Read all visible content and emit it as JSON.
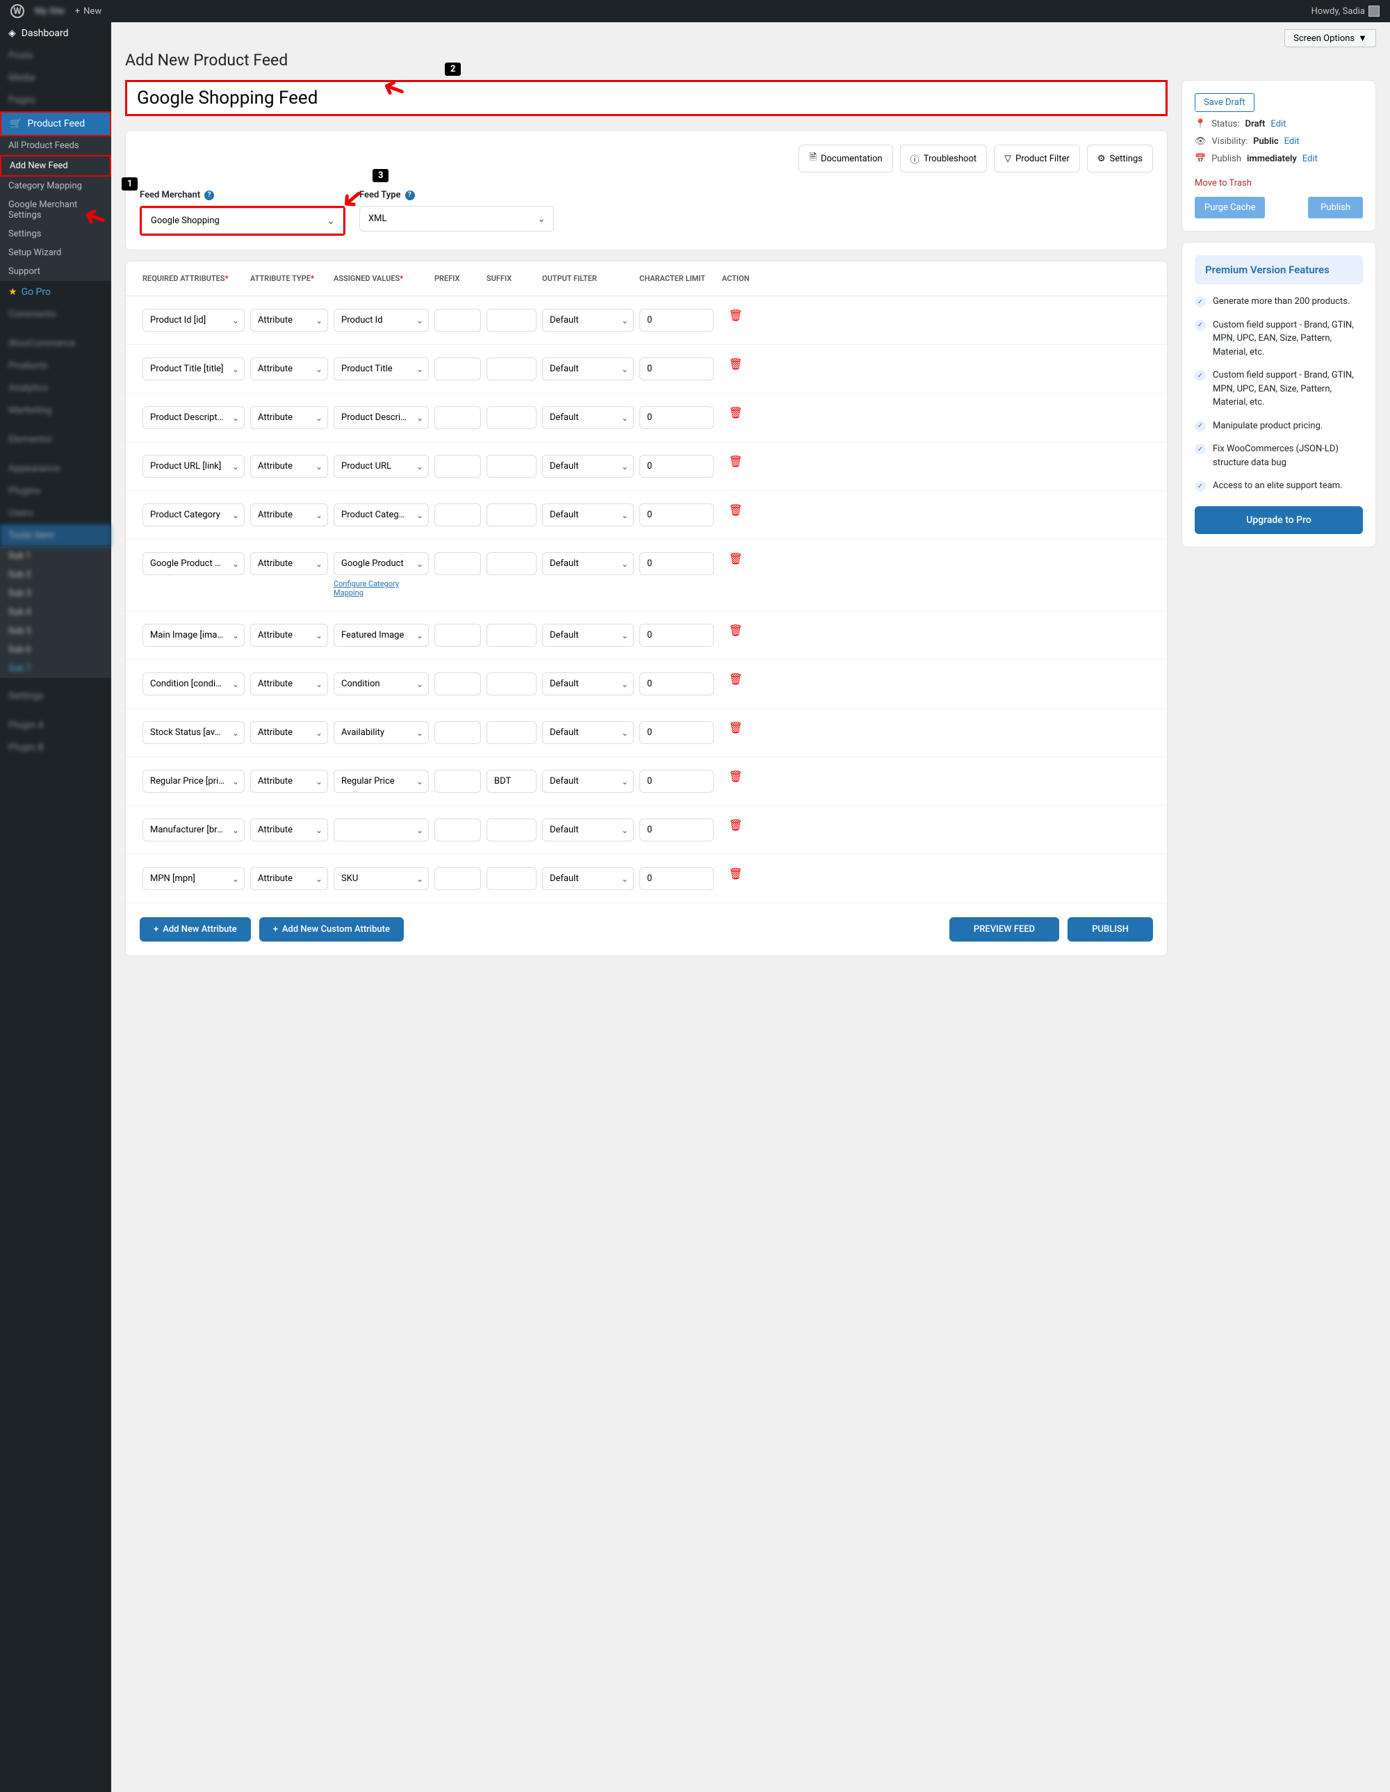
{
  "adminbar": {
    "new": "New",
    "howdy": "Howdy, Sadia"
  },
  "sidebar": {
    "dashboard": "Dashboard",
    "product_feed": "Product Feed",
    "submenu": [
      "All Product Feeds",
      "Add New Feed",
      "Category Mapping",
      "Google Merchant Settings",
      "Settings",
      "Setup Wizard",
      "Support"
    ],
    "gopro": "Go Pro"
  },
  "page_title": "Add New Product Feed",
  "feed_title": "Google Shopping Feed",
  "screen_options": "Screen Options",
  "toolbar": {
    "doc": "Documentation",
    "trouble": "Troubleshoot",
    "filter": "Product Filter",
    "settings": "Settings"
  },
  "merchant": {
    "label": "Feed Merchant",
    "value": "Google Shopping"
  },
  "feedtype": {
    "label": "Feed Type",
    "value": "XML"
  },
  "headers": {
    "req": "REQUIRED ATTRIBUTES",
    "type": "ATTRIBUTE TYPE",
    "val": "ASSIGNED VALUES",
    "prefix": "PREFIX",
    "suffix": "SUFFIX",
    "filter": "OUTPUT FILTER",
    "char": "CHARACTER LIMIT",
    "action": "ACTION"
  },
  "rows": [
    {
      "req": "Product Id [id]",
      "type": "Attribute",
      "val": "Product Id",
      "prefix": "",
      "suffix": "",
      "filter": "Default",
      "char": "0"
    },
    {
      "req": "Product Title [title]",
      "type": "Attribute",
      "val": "Product Title",
      "prefix": "",
      "suffix": "",
      "filter": "Default",
      "char": "0"
    },
    {
      "req": "Product Description",
      "type": "Attribute",
      "val": "Product Description",
      "prefix": "",
      "suffix": "",
      "filter": "Default",
      "char": "0"
    },
    {
      "req": "Product URL [link]",
      "type": "Attribute",
      "val": "Product URL",
      "prefix": "",
      "suffix": "",
      "filter": "Default",
      "char": "0"
    },
    {
      "req": "Product Category",
      "type": "Attribute",
      "val": "Product Category",
      "prefix": "",
      "suffix": "",
      "filter": "Default",
      "char": "0"
    },
    {
      "req": "Google Product Category",
      "type": "Attribute",
      "val": "Google Product",
      "prefix": "",
      "suffix": "",
      "filter": "Default",
      "char": "0",
      "cfg": true
    },
    {
      "req": "Main Image [image_link]",
      "type": "Attribute",
      "val": "Featured Image",
      "prefix": "",
      "suffix": "",
      "filter": "Default",
      "char": "0"
    },
    {
      "req": "Condition [condition]",
      "type": "Attribute",
      "val": "Condition",
      "prefix": "",
      "suffix": "",
      "filter": "Default",
      "char": "0"
    },
    {
      "req": "Stock Status [availability]",
      "type": "Attribute",
      "val": "Availability",
      "prefix": "",
      "suffix": "",
      "filter": "Default",
      "char": "0"
    },
    {
      "req": "Regular Price [price]",
      "type": "Attribute",
      "val": "Regular Price",
      "prefix": "",
      "suffix": "BDT",
      "filter": "Default",
      "char": "0"
    },
    {
      "req": "Manufacturer [brand]",
      "type": "Attribute",
      "val": "",
      "prefix": "",
      "suffix": "",
      "filter": "Default",
      "char": "0"
    },
    {
      "req": "MPN [mpn]",
      "type": "Attribute",
      "val": "SKU",
      "prefix": "",
      "suffix": "",
      "filter": "Default",
      "char": "0"
    }
  ],
  "cfg_link": "Configure Category Mapping",
  "actions": {
    "add_attr": "Add New Attribute",
    "add_custom": "Add New Custom Attribute",
    "preview": "PREVIEW FEED",
    "publish": "PUBLISH"
  },
  "publish_box": {
    "save_draft": "Save Draft",
    "status_label": "Status:",
    "status_value": "Draft",
    "visibility_label": "Visibility:",
    "visibility_value": "Public",
    "schedule_label": "Publish",
    "schedule_value": "immediately",
    "edit": "Edit",
    "trash": "Move to Trash",
    "purge": "Purge Cache",
    "publish": "Publish"
  },
  "premium": {
    "title": "Premium Version Features",
    "features": [
      "Generate more than 200 products.",
      "Custom field support - Brand, GTIN, MPN, UPC, EAN, Size, Pattern, Material, etc.",
      "Custom field support - Brand, GTIN, MPN, UPC, EAN, Size, Pattern, Material, etc.",
      "Manipulate product pricing.",
      "Fix WooCommerces (JSON-LD) structure data bug",
      "Access to an elite support team."
    ],
    "upgrade": "Upgrade to Pro"
  },
  "annotations": {
    "n1": "1",
    "n2": "2",
    "n3": "3"
  }
}
